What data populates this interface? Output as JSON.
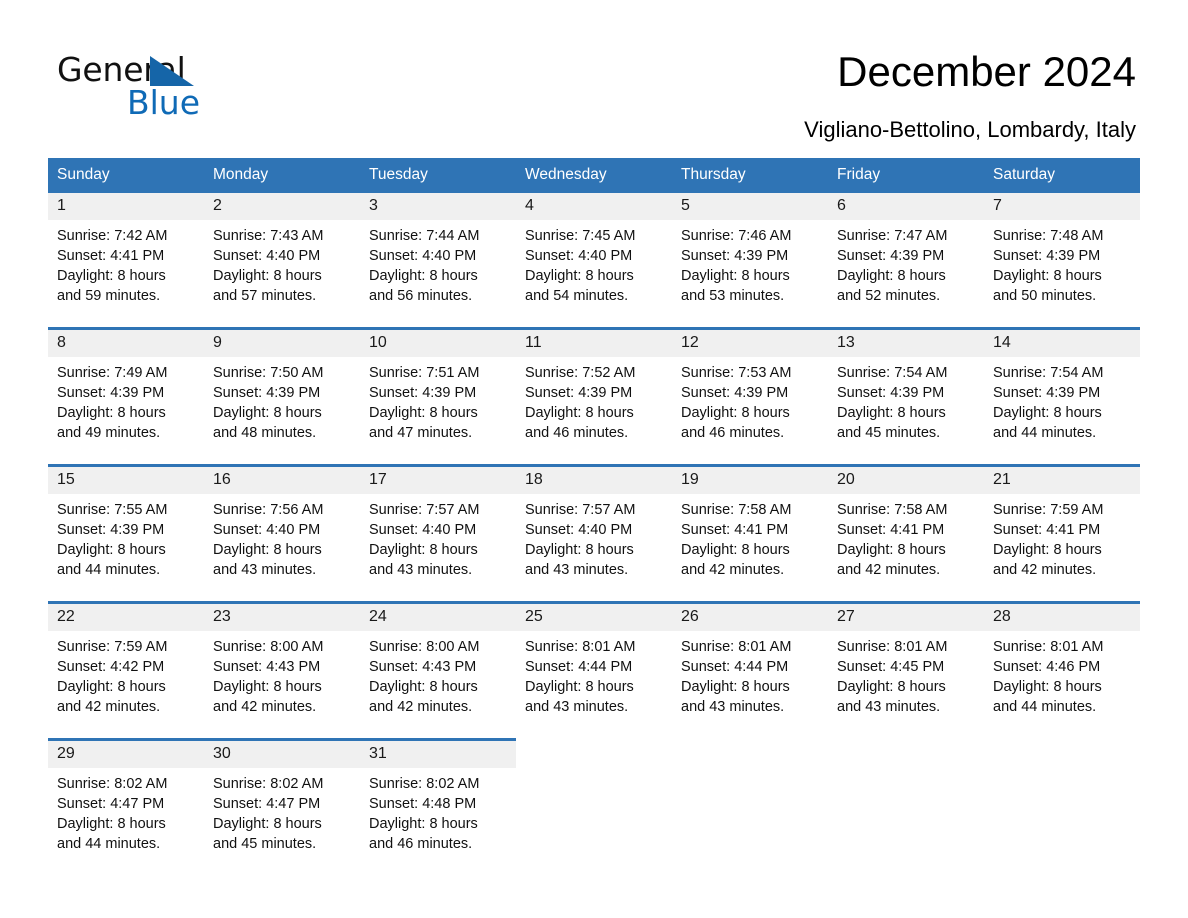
{
  "brand": {
    "name_part1": "General",
    "name_part2": "Blue",
    "triangle_color": "#1565a8",
    "blue_color": "#0f6ab6"
  },
  "header": {
    "title": "December 2024",
    "subtitle": "Vigliano-Bettolino, Lombardy, Italy",
    "header_bg": "#2f74b5",
    "daynum_bg": "#f0f0f0"
  },
  "weekday_headers": [
    "Sunday",
    "Monday",
    "Tuesday",
    "Wednesday",
    "Thursday",
    "Friday",
    "Saturday"
  ],
  "weeks": [
    [
      {
        "day": "1",
        "sunrise": "Sunrise: 7:42 AM",
        "sunset": "Sunset: 4:41 PM",
        "daylight1": "Daylight: 8 hours",
        "daylight2": "and 59 minutes."
      },
      {
        "day": "2",
        "sunrise": "Sunrise: 7:43 AM",
        "sunset": "Sunset: 4:40 PM",
        "daylight1": "Daylight: 8 hours",
        "daylight2": "and 57 minutes."
      },
      {
        "day": "3",
        "sunrise": "Sunrise: 7:44 AM",
        "sunset": "Sunset: 4:40 PM",
        "daylight1": "Daylight: 8 hours",
        "daylight2": "and 56 minutes."
      },
      {
        "day": "4",
        "sunrise": "Sunrise: 7:45 AM",
        "sunset": "Sunset: 4:40 PM",
        "daylight1": "Daylight: 8 hours",
        "daylight2": "and 54 minutes."
      },
      {
        "day": "5",
        "sunrise": "Sunrise: 7:46 AM",
        "sunset": "Sunset: 4:39 PM",
        "daylight1": "Daylight: 8 hours",
        "daylight2": "and 53 minutes."
      },
      {
        "day": "6",
        "sunrise": "Sunrise: 7:47 AM",
        "sunset": "Sunset: 4:39 PM",
        "daylight1": "Daylight: 8 hours",
        "daylight2": "and 52 minutes."
      },
      {
        "day": "7",
        "sunrise": "Sunrise: 7:48 AM",
        "sunset": "Sunset: 4:39 PM",
        "daylight1": "Daylight: 8 hours",
        "daylight2": "and 50 minutes."
      }
    ],
    [
      {
        "day": "8",
        "sunrise": "Sunrise: 7:49 AM",
        "sunset": "Sunset: 4:39 PM",
        "daylight1": "Daylight: 8 hours",
        "daylight2": "and 49 minutes."
      },
      {
        "day": "9",
        "sunrise": "Sunrise: 7:50 AM",
        "sunset": "Sunset: 4:39 PM",
        "daylight1": "Daylight: 8 hours",
        "daylight2": "and 48 minutes."
      },
      {
        "day": "10",
        "sunrise": "Sunrise: 7:51 AM",
        "sunset": "Sunset: 4:39 PM",
        "daylight1": "Daylight: 8 hours",
        "daylight2": "and 47 minutes."
      },
      {
        "day": "11",
        "sunrise": "Sunrise: 7:52 AM",
        "sunset": "Sunset: 4:39 PM",
        "daylight1": "Daylight: 8 hours",
        "daylight2": "and 46 minutes."
      },
      {
        "day": "12",
        "sunrise": "Sunrise: 7:53 AM",
        "sunset": "Sunset: 4:39 PM",
        "daylight1": "Daylight: 8 hours",
        "daylight2": "and 46 minutes."
      },
      {
        "day": "13",
        "sunrise": "Sunrise: 7:54 AM",
        "sunset": "Sunset: 4:39 PM",
        "daylight1": "Daylight: 8 hours",
        "daylight2": "and 45 minutes."
      },
      {
        "day": "14",
        "sunrise": "Sunrise: 7:54 AM",
        "sunset": "Sunset: 4:39 PM",
        "daylight1": "Daylight: 8 hours",
        "daylight2": "and 44 minutes."
      }
    ],
    [
      {
        "day": "15",
        "sunrise": "Sunrise: 7:55 AM",
        "sunset": "Sunset: 4:39 PM",
        "daylight1": "Daylight: 8 hours",
        "daylight2": "and 44 minutes."
      },
      {
        "day": "16",
        "sunrise": "Sunrise: 7:56 AM",
        "sunset": "Sunset: 4:40 PM",
        "daylight1": "Daylight: 8 hours",
        "daylight2": "and 43 minutes."
      },
      {
        "day": "17",
        "sunrise": "Sunrise: 7:57 AM",
        "sunset": "Sunset: 4:40 PM",
        "daylight1": "Daylight: 8 hours",
        "daylight2": "and 43 minutes."
      },
      {
        "day": "18",
        "sunrise": "Sunrise: 7:57 AM",
        "sunset": "Sunset: 4:40 PM",
        "daylight1": "Daylight: 8 hours",
        "daylight2": "and 43 minutes."
      },
      {
        "day": "19",
        "sunrise": "Sunrise: 7:58 AM",
        "sunset": "Sunset: 4:41 PM",
        "daylight1": "Daylight: 8 hours",
        "daylight2": "and 42 minutes."
      },
      {
        "day": "20",
        "sunrise": "Sunrise: 7:58 AM",
        "sunset": "Sunset: 4:41 PM",
        "daylight1": "Daylight: 8 hours",
        "daylight2": "and 42 minutes."
      },
      {
        "day": "21",
        "sunrise": "Sunrise: 7:59 AM",
        "sunset": "Sunset: 4:41 PM",
        "daylight1": "Daylight: 8 hours",
        "daylight2": "and 42 minutes."
      }
    ],
    [
      {
        "day": "22",
        "sunrise": "Sunrise: 7:59 AM",
        "sunset": "Sunset: 4:42 PM",
        "daylight1": "Daylight: 8 hours",
        "daylight2": "and 42 minutes."
      },
      {
        "day": "23",
        "sunrise": "Sunrise: 8:00 AM",
        "sunset": "Sunset: 4:43 PM",
        "daylight1": "Daylight: 8 hours",
        "daylight2": "and 42 minutes."
      },
      {
        "day": "24",
        "sunrise": "Sunrise: 8:00 AM",
        "sunset": "Sunset: 4:43 PM",
        "daylight1": "Daylight: 8 hours",
        "daylight2": "and 42 minutes."
      },
      {
        "day": "25",
        "sunrise": "Sunrise: 8:01 AM",
        "sunset": "Sunset: 4:44 PM",
        "daylight1": "Daylight: 8 hours",
        "daylight2": "and 43 minutes."
      },
      {
        "day": "26",
        "sunrise": "Sunrise: 8:01 AM",
        "sunset": "Sunset: 4:44 PM",
        "daylight1": "Daylight: 8 hours",
        "daylight2": "and 43 minutes."
      },
      {
        "day": "27",
        "sunrise": "Sunrise: 8:01 AM",
        "sunset": "Sunset: 4:45 PM",
        "daylight1": "Daylight: 8 hours",
        "daylight2": "and 43 minutes."
      },
      {
        "day": "28",
        "sunrise": "Sunrise: 8:01 AM",
        "sunset": "Sunset: 4:46 PM",
        "daylight1": "Daylight: 8 hours",
        "daylight2": "and 44 minutes."
      }
    ],
    [
      {
        "day": "29",
        "sunrise": "Sunrise: 8:02 AM",
        "sunset": "Sunset: 4:47 PM",
        "daylight1": "Daylight: 8 hours",
        "daylight2": "and 44 minutes."
      },
      {
        "day": "30",
        "sunrise": "Sunrise: 8:02 AM",
        "sunset": "Sunset: 4:47 PM",
        "daylight1": "Daylight: 8 hours",
        "daylight2": "and 45 minutes."
      },
      {
        "day": "31",
        "sunrise": "Sunrise: 8:02 AM",
        "sunset": "Sunset: 4:48 PM",
        "daylight1": "Daylight: 8 hours",
        "daylight2": "and 46 minutes."
      },
      {
        "day": "",
        "sunrise": "",
        "sunset": "",
        "daylight1": "",
        "daylight2": ""
      },
      {
        "day": "",
        "sunrise": "",
        "sunset": "",
        "daylight1": "",
        "daylight2": ""
      },
      {
        "day": "",
        "sunrise": "",
        "sunset": "",
        "daylight1": "",
        "daylight2": ""
      },
      {
        "day": "",
        "sunrise": "",
        "sunset": "",
        "daylight1": "",
        "daylight2": ""
      }
    ]
  ]
}
